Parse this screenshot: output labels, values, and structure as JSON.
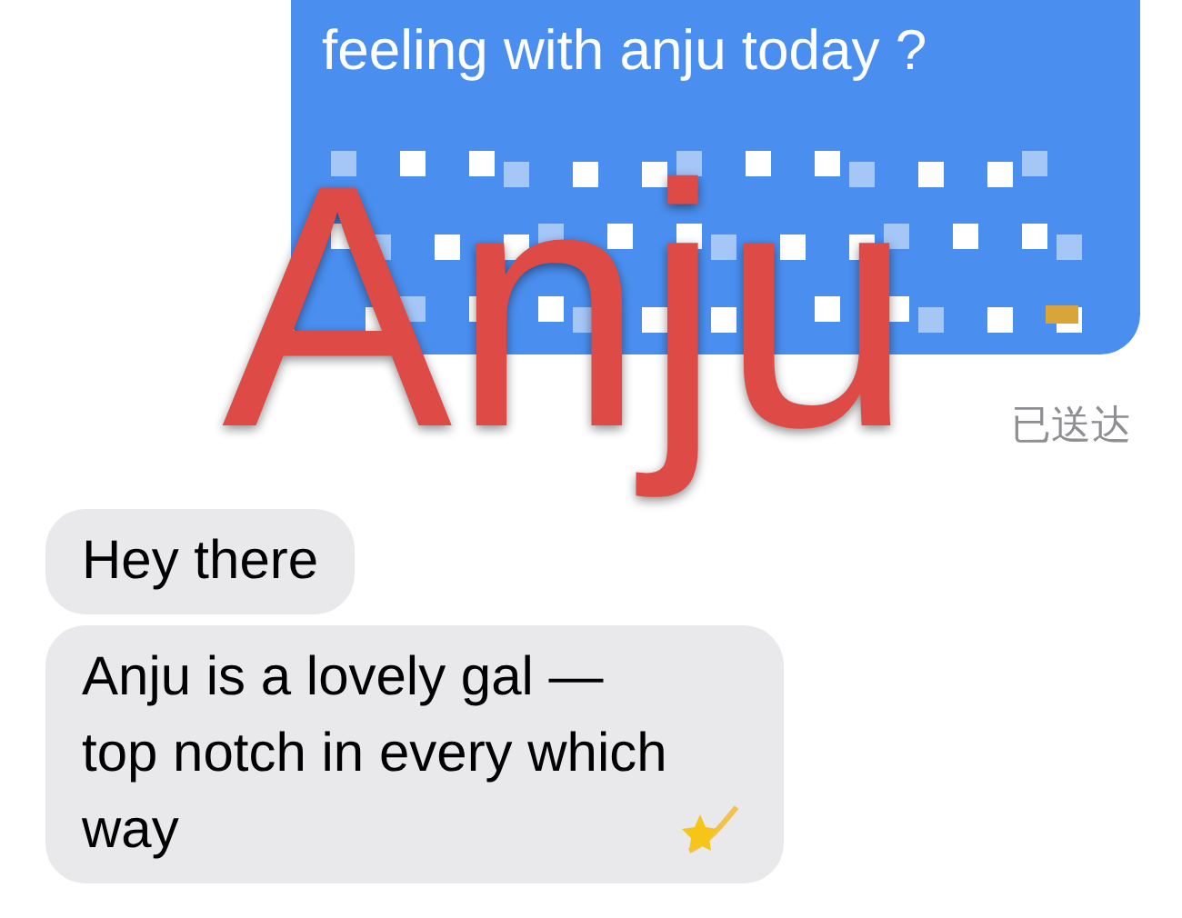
{
  "sent_message": {
    "text": "feeling with anju today ?",
    "redacted": true,
    "status": "已送达"
  },
  "received_messages": [
    {
      "lines": [
        "Hey there"
      ],
      "has_icon": false
    },
    {
      "lines": [
        "Anju is a lovely gal —",
        "top notch in every which",
        "way"
      ],
      "has_icon": true
    }
  ],
  "overlay_text": "Anju"
}
